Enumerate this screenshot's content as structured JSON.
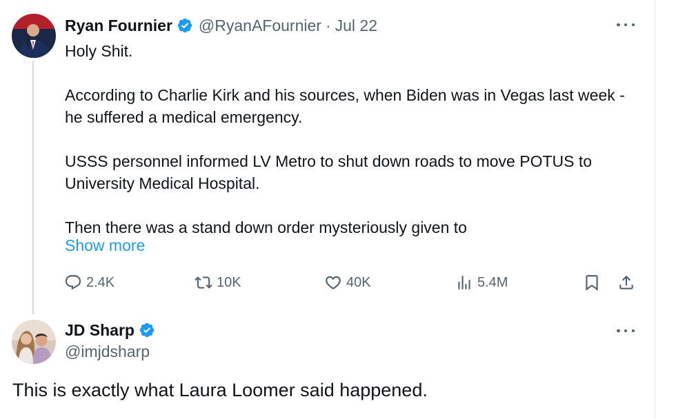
{
  "original_tweet": {
    "display_name": "Ryan Fournier",
    "handle": "@RyanAFournier",
    "separator": "·",
    "date": "Jul 22",
    "text_lines": [
      "Holy Shit.",
      "According to Charlie Kirk and his sources, when Biden was in Vegas last week - he suffered a medical emergency.",
      "USSS personnel informed LV Metro to shut down roads to move POTUS to University Medical Hospital.",
      "Then there was a stand down order mysteriously given to"
    ],
    "show_more": "Show more",
    "stats": {
      "replies": "2.4K",
      "retweets": "10K",
      "likes": "40K",
      "views": "5.4M"
    },
    "icons": [
      "verified-badge-icon",
      "more-icon",
      "reply-icon",
      "retweet-icon",
      "like-icon",
      "views-icon",
      "bookmark-icon",
      "share-icon"
    ]
  },
  "reply_tweet": {
    "display_name": "JD Sharp",
    "handle": "@imjdsharp",
    "text": "This is exactly what Laura Loomer said happened."
  },
  "colors": {
    "text": "#0f1419",
    "secondary": "#536471",
    "link": "#1d9bf0",
    "verified": "#1d9bf0",
    "thread_line": "#cfd9de"
  }
}
